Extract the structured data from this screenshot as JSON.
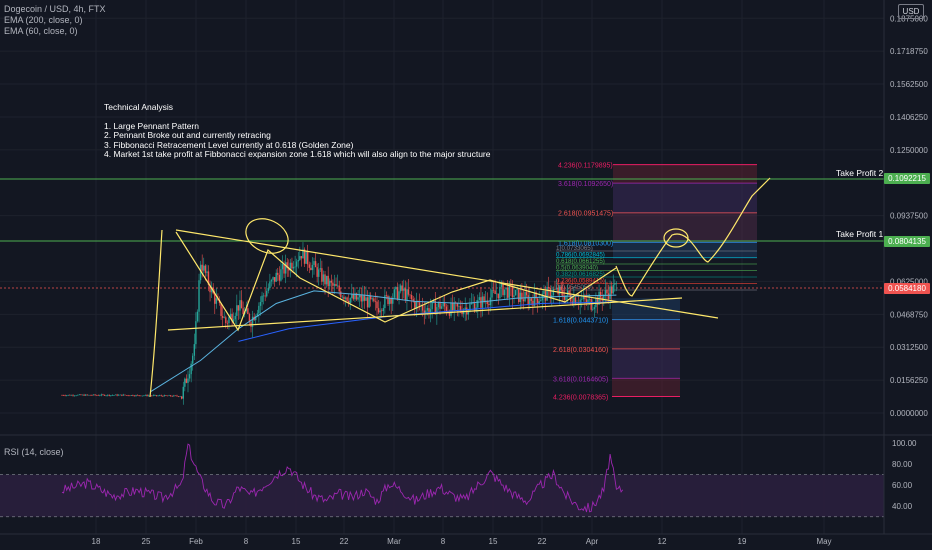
{
  "legend": {
    "symbol": "Dogecoin / USD, 4h, FTX",
    "ema200": "EMA (200, close, 0)",
    "ema60": "EMA (60, close, 0)"
  },
  "currency_button": "USD",
  "rsi_legend": "RSI (14, close)",
  "notes": {
    "title": "Technical Analysis",
    "lines": [
      "1. Large Pennant Pattern",
      "2. Pennant Broke out and currently retracing",
      "3. Fibbonacci Retracement Level currently at 0.618 (Golden Zone)",
      "4. Market 1st take profit at Fibbonacci expansion zone 1.618 which will also align to the major structure"
    ]
  },
  "take_profit": {
    "tp1_label": "Take Profit 1",
    "tp1_price": "0.0804135",
    "tp2_label": "Take Profit 2",
    "tp2_price": "0.1092215"
  },
  "last_price": "0.0584180",
  "colors": {
    "background": "#131722",
    "up": "#26a69a",
    "down": "#ef5350",
    "ema60": "#5ab4e0",
    "ema200": "#2962ff",
    "drawing": "#ffe86b",
    "tp_line": "#4caf50",
    "rsi": "#9c27b0"
  },
  "chart_data": {
    "type": "candlestick",
    "title": "Dogecoin / USD, 4h, FTX",
    "x_ticks": [
      "18",
      "25",
      "Feb",
      "8",
      "15",
      "22",
      "Mar",
      "8",
      "15",
      "22",
      "Apr",
      "12",
      "19",
      "May"
    ],
    "y_ticks": [
      "0.1875000",
      "0.1718750",
      "0.1562500",
      "0.1406250",
      "0.1250000",
      "0.0937500",
      "0.0625000",
      "0.0468750",
      "0.0312500",
      "0.0156250",
      "0.0000000"
    ],
    "ylim": [
      0,
      0.19
    ],
    "price_path": [
      [
        0,
        0.0085
      ],
      [
        10,
        0.0085
      ],
      [
        19,
        0.008
      ],
      [
        21,
        0.03
      ],
      [
        22,
        0.072
      ],
      [
        24,
        0.056
      ],
      [
        26,
        0.043
      ],
      [
        28,
        0.051
      ],
      [
        30,
        0.044
      ],
      [
        32,
        0.056
      ],
      [
        34,
        0.065
      ],
      [
        36,
        0.07
      ],
      [
        38,
        0.076
      ],
      [
        40,
        0.069
      ],
      [
        42,
        0.062
      ],
      [
        44,
        0.058
      ],
      [
        46,
        0.054
      ],
      [
        48,
        0.054
      ],
      [
        50,
        0.05
      ],
      [
        52,
        0.055
      ],
      [
        54,
        0.058
      ],
      [
        56,
        0.052
      ],
      [
        58,
        0.049
      ],
      [
        60,
        0.051
      ],
      [
        62,
        0.049
      ],
      [
        64,
        0.05
      ],
      [
        66,
        0.052
      ],
      [
        68,
        0.055
      ],
      [
        70,
        0.059
      ],
      [
        72,
        0.056
      ],
      [
        74,
        0.054
      ],
      [
        76,
        0.055
      ],
      [
        78,
        0.058
      ],
      [
        80,
        0.056
      ],
      [
        82,
        0.054
      ],
      [
        84,
        0.052
      ],
      [
        86,
        0.056
      ],
      [
        88,
        0.06
      ]
    ],
    "ema60": [
      [
        14,
        0.01
      ],
      [
        22,
        0.025
      ],
      [
        28,
        0.04
      ],
      [
        34,
        0.052
      ],
      [
        40,
        0.058
      ],
      [
        48,
        0.056
      ],
      [
        56,
        0.053
      ],
      [
        64,
        0.052
      ],
      [
        72,
        0.0545
      ],
      [
        80,
        0.0555
      ],
      [
        88,
        0.056
      ]
    ],
    "ema200": [
      [
        28,
        0.034
      ],
      [
        36,
        0.04
      ],
      [
        44,
        0.043
      ],
      [
        52,
        0.046
      ],
      [
        60,
        0.048
      ],
      [
        68,
        0.05
      ],
      [
        76,
        0.052
      ],
      [
        84,
        0.0525
      ],
      [
        88,
        0.0528
      ]
    ],
    "fib_retracement_labels": [
      "1(0.0733065)",
      "0.786(0.0692845)",
      "0.618(0.0661255)",
      "0.5(0.0639040)",
      "0.382(0.0616825)",
      "0.236(0.0589415)",
      "0(0.0545050)"
    ],
    "fib_expansion_up": [
      {
        "label": "1.618(0.0810300)",
        "value": 0.08103
      },
      {
        "label": "2.618(0.0951475)",
        "value": 0.0951475
      },
      {
        "label": "3.618(0.1092650)",
        "value": 0.109265
      },
      {
        "label": "4.236(0.1179895)",
        "value": 0.1179895
      }
    ],
    "fib_expansion_down": [
      {
        "label": "1.618(0.0443710)",
        "value": 0.044371
      },
      {
        "label": "2.618(0.0304160)",
        "value": 0.030416
      },
      {
        "label": "3.618(0.0164605)",
        "value": 0.0164605
      },
      {
        "label": "4.236(0.0078365)",
        "value": 0.0078365
      }
    ],
    "rsi": {
      "name": "RSI (14, close)",
      "levels": [
        70,
        30
      ],
      "y_ticks": [
        "100.00",
        "80.00",
        "60.00",
        "40.00"
      ],
      "ylim": [
        25,
        100
      ],
      "values": [
        [
          0,
          55
        ],
        [
          4,
          62
        ],
        [
          8,
          50
        ],
        [
          12,
          55
        ],
        [
          16,
          48
        ],
        [
          19,
          60
        ],
        [
          20,
          98
        ],
        [
          21,
          80
        ],
        [
          22,
          65
        ],
        [
          24,
          45
        ],
        [
          26,
          40
        ],
        [
          28,
          58
        ],
        [
          30,
          50
        ],
        [
          32,
          60
        ],
        [
          34,
          70
        ],
        [
          36,
          78
        ],
        [
          38,
          62
        ],
        [
          40,
          50
        ],
        [
          42,
          45
        ],
        [
          44,
          52
        ],
        [
          46,
          48
        ],
        [
          48,
          55
        ],
        [
          50,
          45
        ],
        [
          52,
          62
        ],
        [
          54,
          55
        ],
        [
          56,
          45
        ],
        [
          58,
          52
        ],
        [
          60,
          58
        ],
        [
          62,
          50
        ],
        [
          64,
          46
        ],
        [
          66,
          60
        ],
        [
          68,
          72
        ],
        [
          70,
          60
        ],
        [
          72,
          50
        ],
        [
          74,
          45
        ],
        [
          76,
          60
        ],
        [
          78,
          70
        ],
        [
          80,
          50
        ],
        [
          82,
          40
        ],
        [
          84,
          38
        ],
        [
          86,
          55
        ],
        [
          87,
          88
        ],
        [
          88,
          55
        ],
        [
          89,
          56
        ]
      ]
    }
  }
}
